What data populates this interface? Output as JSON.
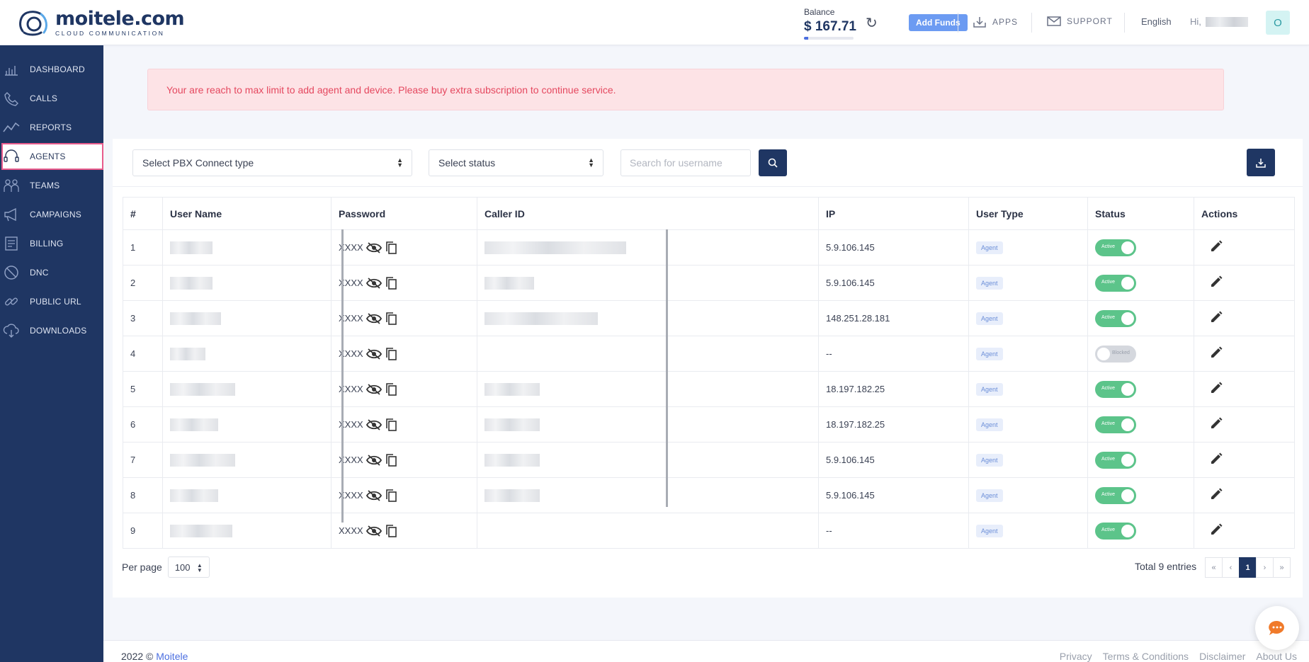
{
  "brand": {
    "name": "moitele.com",
    "tagline": "CLOUD COMMUNICATION"
  },
  "header": {
    "balance_label": "Balance",
    "balance_amount": "$ 167.71",
    "balance_bar_fraction": 0.08,
    "add_funds_label": "Add Funds",
    "apps_label": "APPS",
    "support_label": "SUPPORT",
    "language": "English",
    "greeting": "Hi,",
    "avatar_initial": "O"
  },
  "sidebar": {
    "items": [
      {
        "label": "DASHBOARD",
        "icon": "dashboard-icon"
      },
      {
        "label": "CALLS",
        "icon": "phone-icon"
      },
      {
        "label": "REPORTS",
        "icon": "reports-icon"
      },
      {
        "label": "AGENTS",
        "icon": "headset-icon",
        "active": true
      },
      {
        "label": "TEAMS",
        "icon": "teams-icon"
      },
      {
        "label": "CAMPAIGNS",
        "icon": "megaphone-icon"
      },
      {
        "label": "BILLING",
        "icon": "billing-icon"
      },
      {
        "label": "DNC",
        "icon": "block-icon"
      },
      {
        "label": "PUBLIC URL",
        "icon": "link-icon"
      },
      {
        "label": "DOWNLOADS",
        "icon": "cloud-download-icon"
      }
    ]
  },
  "alert": {
    "message": "Your are reach to max limit to add agent and device. Please buy extra subscription to continue service."
  },
  "filters": {
    "pbx_type_placeholder": "Select PBX Connect type",
    "status_placeholder": "Select status",
    "search_placeholder": "Search for username"
  },
  "table": {
    "columns": [
      "#",
      "User Name",
      "Password",
      "Caller ID",
      "IP",
      "User Type",
      "Status",
      "Actions"
    ],
    "rows": [
      {
        "num": "1",
        "password": "XXXX",
        "ip": "5.9.106.145",
        "user_type": "Agent",
        "status": "Active"
      },
      {
        "num": "2",
        "password": "XXXX",
        "ip": "5.9.106.145",
        "user_type": "Agent",
        "status": "Active"
      },
      {
        "num": "3",
        "password": "XXXX",
        "ip": "148.251.28.181",
        "user_type": "Agent",
        "status": "Active"
      },
      {
        "num": "4",
        "password": "XXXX",
        "ip": "--",
        "user_type": "Agent",
        "status": "Blocked"
      },
      {
        "num": "5",
        "password": "XXXX",
        "ip": "18.197.182.25",
        "user_type": "Agent",
        "status": "Active"
      },
      {
        "num": "6",
        "password": "XXXX",
        "ip": "18.197.182.25",
        "user_type": "Agent",
        "status": "Active"
      },
      {
        "num": "7",
        "password": "XXXX",
        "ip": "5.9.106.145",
        "user_type": "Agent",
        "status": "Active"
      },
      {
        "num": "8",
        "password": "XXXX",
        "ip": "5.9.106.145",
        "user_type": "Agent",
        "status": "Active"
      },
      {
        "num": "9",
        "password": "XXXX",
        "ip": "--",
        "user_type": "Agent",
        "status": "Active"
      }
    ]
  },
  "pagination": {
    "per_page_label": "Per page",
    "per_page_value": "100",
    "total_text": "Total 9 entries",
    "first": "«",
    "prev": "‹",
    "current": "1",
    "next": "›",
    "last": "»"
  },
  "footer": {
    "copyright": "2022 ©",
    "company": "Moitele",
    "links": [
      "Privacy",
      "Terms & Conditions",
      "Disclaimer",
      "About Us"
    ]
  },
  "colors": {
    "primary": "#1f3663",
    "accent": "#6c9bf2",
    "active_toggle": "#5cc48a",
    "alert_bg": "#fde3e6",
    "alert_text": "#e5485f",
    "active_highlight": "#e85b8c"
  }
}
